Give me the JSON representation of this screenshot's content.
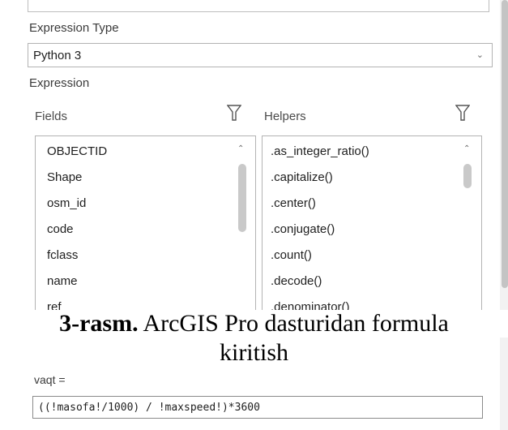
{
  "expression_type": {
    "label": "Expression Type",
    "value": "Python 3"
  },
  "expression_label": "Expression",
  "fields": {
    "header": "Fields",
    "items": [
      "OBJECTID",
      "Shape",
      "osm_id",
      "code",
      "fclass",
      "name",
      "ref"
    ]
  },
  "helpers": {
    "header": "Helpers",
    "items": [
      ".as_integer_ratio()",
      ".capitalize()",
      ".center()",
      ".conjugate()",
      ".count()",
      ".decode()",
      ".denominator()"
    ]
  },
  "caption": {
    "bold": "3-rasm.",
    "line1_rest": " ArcGIS Pro dasturidan formula",
    "line2": "kiritish"
  },
  "code_block": {
    "var_label": "vaqt =",
    "expression": "((!masofa!/1000) / !maxspeed!)*3600"
  },
  "icons": {
    "filter": "filter-icon",
    "chevron": "chevron-down-icon",
    "scroll_up": "chevron-up-icon"
  }
}
